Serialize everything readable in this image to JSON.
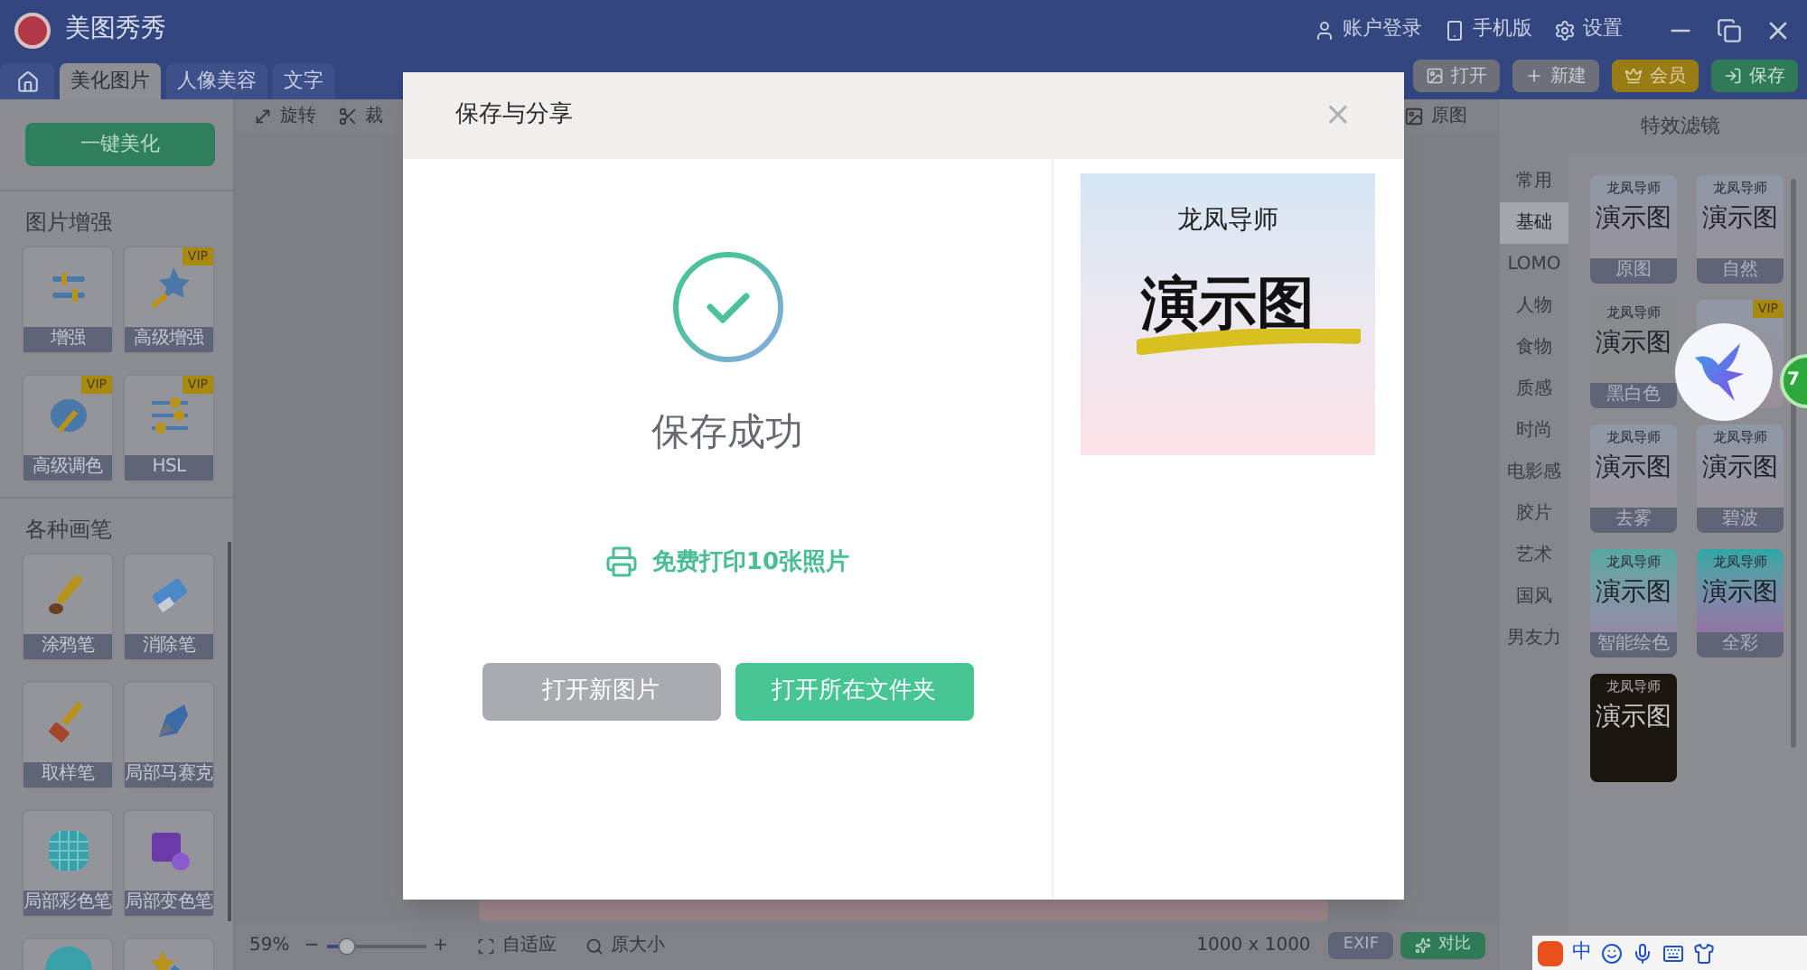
{
  "app": {
    "name": "美图秀秀",
    "links": [
      {
        "label": "账户登录",
        "kind": "user"
      },
      {
        "label": "手机版",
        "kind": "phone"
      },
      {
        "label": "设置",
        "kind": "gear"
      }
    ]
  },
  "tabs": [
    {
      "kind": "home",
      "selected": false
    },
    {
      "kind": "text",
      "label": "美化图片",
      "selected": true
    },
    {
      "kind": "text",
      "label": "人像美容",
      "selected": false
    },
    {
      "kind": "text",
      "label": "文字",
      "selected": false
    }
  ],
  "actions": [
    {
      "label": "打开",
      "kind": "open"
    },
    {
      "label": "新建",
      "kind": "new"
    },
    {
      "label": "会员",
      "kind": "vip"
    },
    {
      "label": "保存",
      "kind": "save"
    }
  ],
  "left_panel": {
    "one_click": "一键美化",
    "sections": [
      {
        "title": "图片增强",
        "tools": [
          {
            "label": "增强",
            "kind": "sliders"
          },
          {
            "label": "高级增强",
            "kind": "wand",
            "badge": "VIP"
          },
          {
            "label": "高级调色",
            "kind": "palette",
            "badge": "VIP"
          },
          {
            "label": "HSL",
            "kind": "hsl",
            "badge": "VIP"
          }
        ]
      },
      {
        "title": "各种画笔",
        "tools": [
          {
            "label": "涂鸦笔",
            "kind": "brush"
          },
          {
            "label": "消除笔",
            "kind": "eraser"
          },
          {
            "label": "取样笔",
            "kind": "paintbrush"
          },
          {
            "label": "局部马赛克",
            "kind": "pen"
          },
          {
            "label": "局部彩色笔",
            "kind": "checker"
          },
          {
            "label": "局部变色笔",
            "kind": "square"
          },
          {
            "kind": "blob"
          },
          {
            "kind": "star"
          }
        ]
      }
    ]
  },
  "toolbar": {
    "tools": [
      {
        "label": "旋转",
        "kind": "rotate"
      },
      {
        "label": "裁",
        "kind": "crop"
      }
    ],
    "original": "原图"
  },
  "bottom_bar": {
    "zoom": "59%",
    "minus": "−",
    "plus": "+",
    "slider": {
      "level": 0.2
    },
    "views": [
      {
        "label": "自适应",
        "kind": "fit"
      },
      {
        "label": "原大小",
        "kind": "actual"
      }
    ],
    "size": "1000 x 1000",
    "exif": "EXIF",
    "compare": "对比"
  },
  "filters_panel": {
    "title": "特效滤镜",
    "categories": [
      {
        "label": "常用",
        "selected": false
      },
      {
        "label": "基础",
        "selected": true
      },
      {
        "label": "LOMO",
        "selected": false
      },
      {
        "label": "人物",
        "selected": false
      },
      {
        "label": "食物",
        "selected": false
      },
      {
        "label": "质感",
        "selected": false
      },
      {
        "label": "时尚",
        "selected": false
      },
      {
        "label": "电影感",
        "selected": false
      },
      {
        "label": "胶片",
        "selected": false
      },
      {
        "label": "艺术",
        "selected": false
      },
      {
        "label": "国风",
        "selected": false
      },
      {
        "label": "男友力",
        "selected": false
      }
    ],
    "items": [
      {
        "label": "原图",
        "caption": "龙凤导师",
        "sample": "演示图",
        "kind": "plain"
      },
      {
        "label": "自然",
        "caption": "龙凤导师",
        "sample": "演示图",
        "kind": "plain"
      },
      {
        "label": "黑白色",
        "caption": "龙凤导师",
        "sample": "演示图",
        "kind": "gray"
      },
      {
        "kind": "plain",
        "badge": "VIP"
      },
      {
        "label": "去雾",
        "caption": "龙凤导师",
        "sample": "演示图",
        "kind": "plain"
      },
      {
        "label": "碧波",
        "caption": "龙凤导师",
        "sample": "演示图",
        "kind": "plain"
      },
      {
        "label": "智能绘色",
        "caption": "龙凤导师",
        "sample": "演示图",
        "kind": "teal"
      },
      {
        "label": "全彩",
        "caption": "龙凤导师",
        "sample": "演示图",
        "kind": "vivid"
      },
      {
        "caption": "龙凤导师",
        "sample": "演示图",
        "kind": "dark"
      }
    ]
  },
  "dialog": {
    "title": "保存与分享",
    "close": "×",
    "status": "保存成功",
    "print_link": "免费打印10张照片",
    "buttons": [
      {
        "label": "打开新图片",
        "kind": "secondary"
      },
      {
        "label": "打开所在文件夹",
        "kind": "primary"
      }
    ],
    "preview": {
      "caption": "龙凤导师",
      "sample": "演示图"
    }
  },
  "float_badge": "7",
  "ime": {
    "label": "中"
  }
}
